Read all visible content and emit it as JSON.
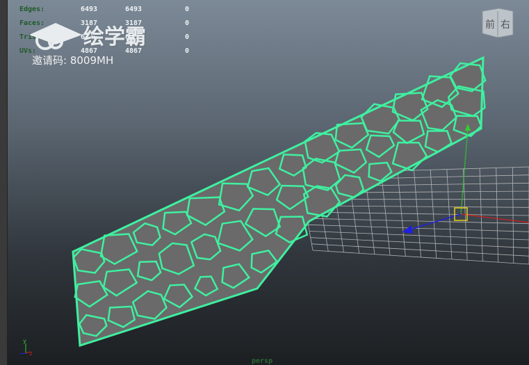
{
  "hud": {
    "rows": [
      {
        "label": "Edges:",
        "a": "6493",
        "b": "6493",
        "c": "0"
      },
      {
        "label": "Faces:",
        "a": "3187",
        "b": "3187",
        "c": "0"
      },
      {
        "label": "Tris:",
        "a": "6500",
        "b": "6500",
        "c": "0"
      },
      {
        "label": "UVs:",
        "a": "4867",
        "b": "4867",
        "c": "0"
      }
    ]
  },
  "watermark": {
    "brand": "绘学霸",
    "code": "邀请码: 8009MH"
  },
  "viewcube": {
    "front": "前",
    "right": "右"
  },
  "axis": {
    "y": "y",
    "x": "x",
    "z": "z"
  },
  "camera_label": "persp",
  "colors": {
    "mesh": "#3ff0a0",
    "grid": "#c8c8c8",
    "manip_y": "#2fd12f",
    "manip_x": "#2020e0",
    "manip_z": "#d02020",
    "pivot": "#e8d020"
  }
}
